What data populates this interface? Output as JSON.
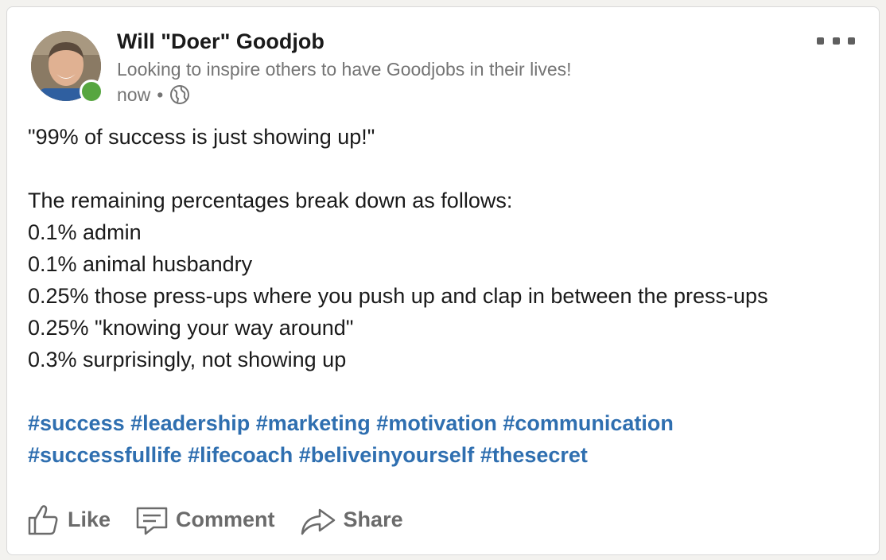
{
  "post": {
    "author": {
      "name": "Will \"Doer\" Goodjob",
      "headline": "Looking to inspire others to have Goodjobs in their lives!",
      "timestamp": "now",
      "separator": "•",
      "visibility_icon": "globe-icon",
      "presence_status_color": "#57a640"
    },
    "menu_icon": "ellipsis-icon",
    "body_lines": [
      "\"99% of success is just showing up!\"",
      "",
      "The remaining percentages break down as follows:",
      "0.1% admin",
      "0.1% animal husbandry",
      "0.25% those press-ups where you push up and clap in between the press-ups",
      "0.25% \"knowing your way around\"",
      "0.3% surprisingly, not showing up"
    ],
    "hashtags": {
      "row1": [
        "#success",
        "#leadership",
        "#marketing",
        "#motivation",
        "#communication"
      ],
      "row2": [
        "#successfullife",
        "#lifecoach",
        "#beliveinyourself",
        "#thesecret"
      ]
    },
    "actions": {
      "like": "Like",
      "comment": "Comment",
      "share": "Share"
    }
  },
  "colors": {
    "hashtag": "#2f6fb0",
    "action_text": "#6b6b6b",
    "secondary_text": "#747474"
  }
}
